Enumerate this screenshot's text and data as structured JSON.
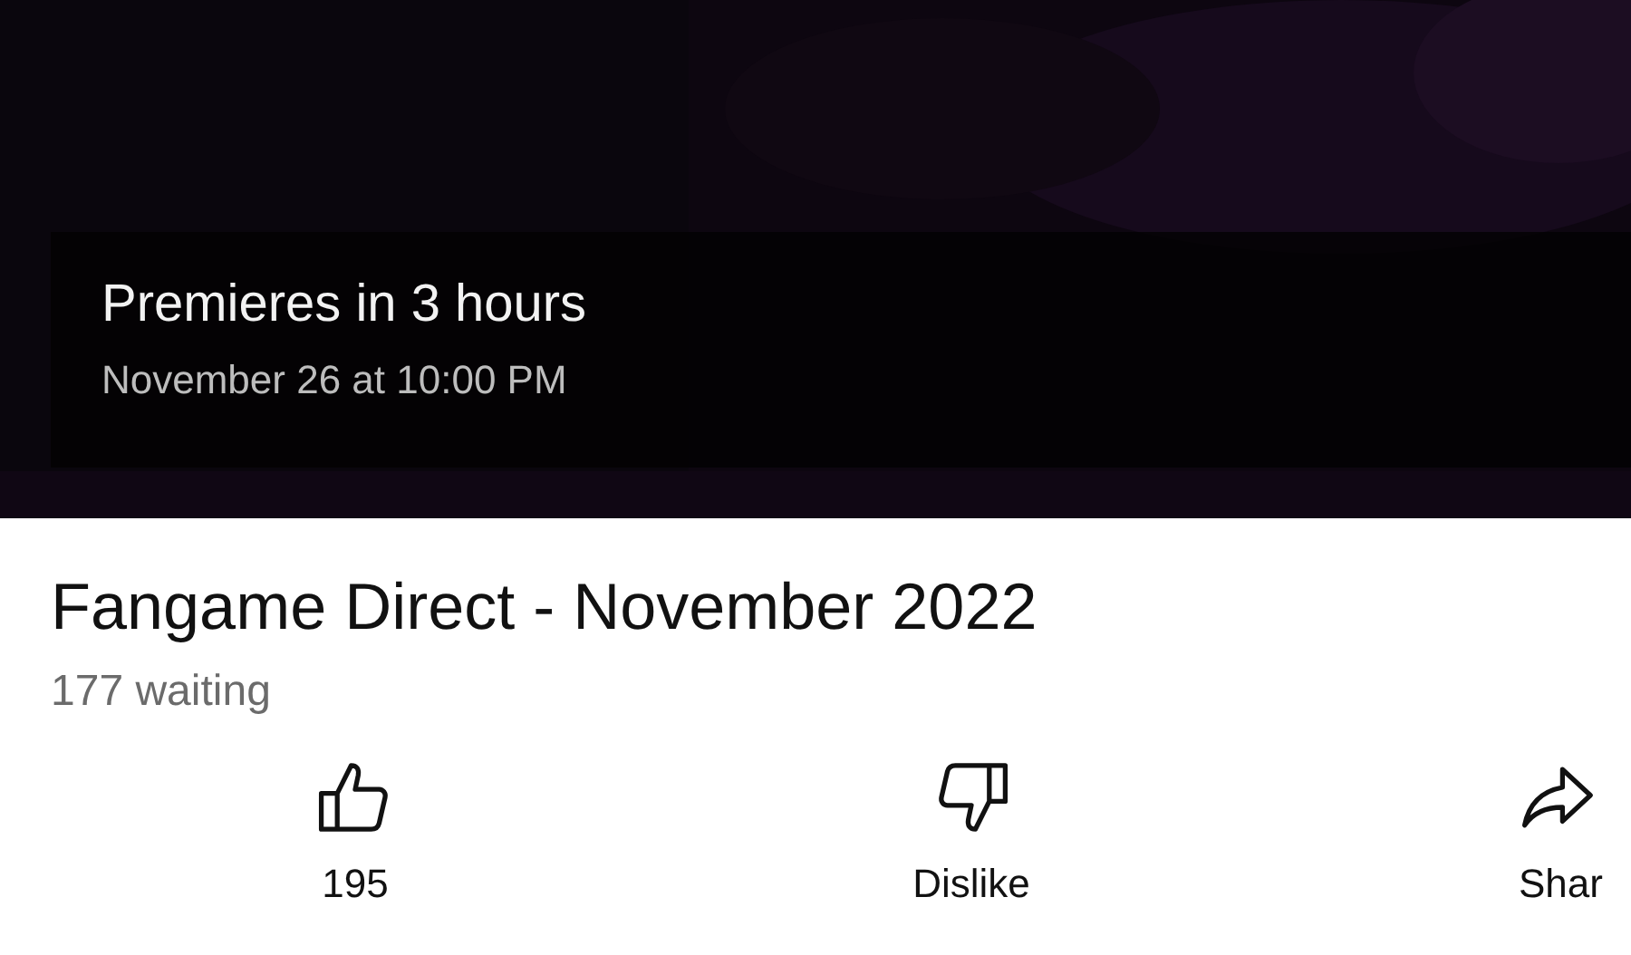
{
  "video": {
    "kind": "picture",
    "premiere": "Premieres in 3 hours",
    "schedule": "November 26 at 10:00 PM"
  },
  "title": "Fangame Direct - November 2022",
  "waiting": "177 waiting",
  "actions": [
    {
      "kind": "like",
      "label": "195"
    },
    {
      "kind": "dislike",
      "label": "Dislike"
    },
    {
      "kind": "share",
      "label": "Shar"
    }
  ]
}
